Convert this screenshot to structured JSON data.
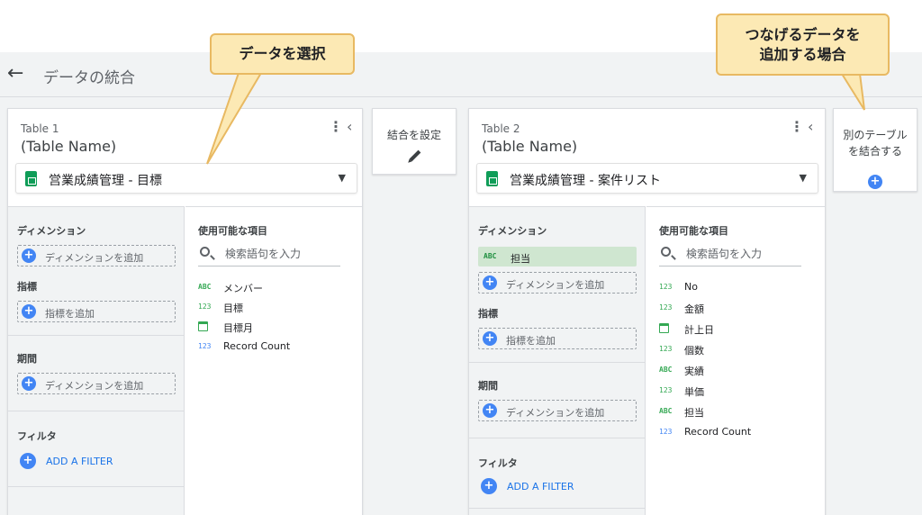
{
  "header": {
    "title": "データの統合"
  },
  "callouts": {
    "select_data": "データを選択",
    "add_data_line1": "つなげるデータを",
    "add_data_line2": "追加する場合"
  },
  "join": {
    "label": "結合を設定"
  },
  "add_table": {
    "line1": "別のテーブル",
    "line2": "を結合する"
  },
  "tables": [
    {
      "title": "Table 1",
      "subtitle": "(Table Name)",
      "source": "営業成績管理 - 目標",
      "sections": {
        "dimension": {
          "title": "ディメンション",
          "add_label": "ディメンションを追加"
        },
        "metric": {
          "title": "指標",
          "add_label": "指標を追加"
        },
        "period": {
          "title": "期間",
          "add_label": "ディメンションを追加"
        },
        "filter": {
          "title": "フィルタ",
          "add_label": "ADD A FILTER"
        }
      },
      "available": {
        "title": "使用可能な項目",
        "search_placeholder": "検索語句を入力",
        "fields": [
          {
            "type": "ABC",
            "label": "メンバー"
          },
          {
            "type": "123",
            "label": "目標"
          },
          {
            "type": "date",
            "label": "目標月"
          },
          {
            "type": "123",
            "label": "Record Count"
          }
        ]
      }
    },
    {
      "title": "Table 2",
      "subtitle": "(Table Name)",
      "source": "営業成績管理 - 案件リスト",
      "sections": {
        "dimension": {
          "title": "ディメンション",
          "add_label": "ディメンションを追加",
          "chip_type": "ABC",
          "chip_label": "担当"
        },
        "metric": {
          "title": "指標",
          "add_label": "指標を追加"
        },
        "period": {
          "title": "期間",
          "add_label": "ディメンションを追加"
        },
        "filter": {
          "title": "フィルタ",
          "add_label": "ADD A FILTER"
        }
      },
      "available": {
        "title": "使用可能な項目",
        "search_placeholder": "検索語句を入力",
        "fields": [
          {
            "type": "123",
            "label": "No"
          },
          {
            "type": "123",
            "label": "金額"
          },
          {
            "type": "date",
            "label": "計上日"
          },
          {
            "type": "123",
            "label": "個数"
          },
          {
            "type": "ABC",
            "label": "実績"
          },
          {
            "type": "123",
            "label": "単価"
          },
          {
            "type": "ABC",
            "label": "担当"
          },
          {
            "type": "123",
            "label": "Record Count"
          }
        ]
      }
    }
  ],
  "colors": {
    "accent": "#4285f4",
    "dimension_green": "#34a853",
    "callout_fill": "#fce9b4",
    "callout_border": "#e8b962"
  },
  "icons": {
    "back": "←",
    "kebab": "⋮",
    "collapse": "‹",
    "dropdown": "▼",
    "plus": "+"
  }
}
